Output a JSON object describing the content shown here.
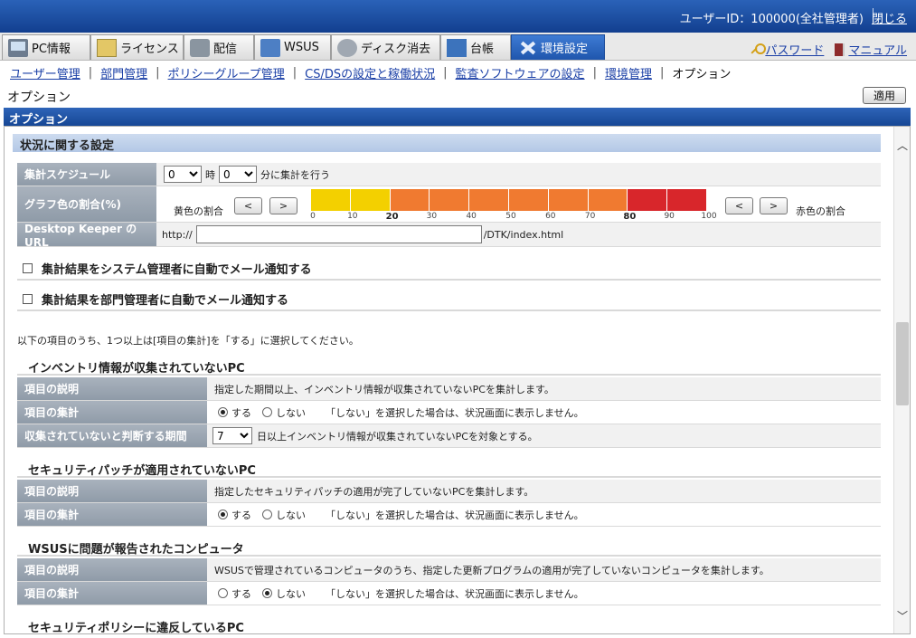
{
  "header": {
    "user_label": "ユーザーID：100000(全社管理者)",
    "close": "閉じる"
  },
  "tabs": [
    {
      "label": "PC情報",
      "icon": "pc-icon"
    },
    {
      "label": "ライセンス",
      "icon": "license-icon"
    },
    {
      "label": "配信",
      "icon": "distribution-icon"
    },
    {
      "label": "WSUS",
      "icon": "wsus-icon"
    },
    {
      "label": "ディスク消去",
      "icon": "disk-erase-icon"
    },
    {
      "label": "台帳",
      "icon": "ledger-icon"
    },
    {
      "label": "環境設定",
      "icon": "tools-icon"
    }
  ],
  "toplinks": {
    "password": "パスワード",
    "manual": "マニュアル"
  },
  "submenu": [
    "ユーザー管理",
    "部門管理",
    "ポリシーグループ管理",
    "CS/DSの設定と稼働状況",
    "監査ソフトウェアの設定",
    "環境管理",
    "オプション"
  ],
  "page": {
    "title": "オプション",
    "apply": "適用",
    "panel_title": "オプション"
  },
  "status_settings": {
    "heading": "状況に関する設定",
    "schedule": {
      "label": "集計スケジュール",
      "hour": "0",
      "hour_unit": "時",
      "minute": "0",
      "suffix": "分に集計を行う"
    },
    "graph": {
      "label": "グラフ色の割合(%)",
      "yellow_label": "黄色の割合",
      "red_label": "赤色の割合",
      "prev": "<",
      "next": ">",
      "ticks": [
        "0",
        "10",
        "20",
        "30",
        "40",
        "50",
        "60",
        "70",
        "80",
        "90",
        "100"
      ],
      "yellow_pct": 20,
      "red_pct": 80,
      "colors": {
        "yellow": "#f3d000",
        "orange": "#f07a30",
        "red": "#d8262b"
      }
    },
    "url": {
      "label": "Desktop Keeper のURL",
      "prefix": "http://",
      "value": "",
      "suffix": "/DTK/index.html"
    }
  },
  "checks": [
    {
      "label": "集計結果をシステム管理者に自動でメール通知する",
      "checked": false
    },
    {
      "label": "集計結果を部門管理者に自動でメール通知する",
      "checked": false
    }
  ],
  "note": "以下の項目のうち、1つ以上は[項目の集計]を「する」に選択してください。",
  "items": [
    {
      "heading": "インベントリ情報が収集されていないPC",
      "desc_label": "項目の説明",
      "desc": "指定した期間以上、インベントリ情報が収集されていないPCを集計します。",
      "count_label": "項目の集計",
      "yes": "する",
      "no": "しない",
      "selected": "yes",
      "hint": "「しない」を選択した場合は、状況画面に表示しません。",
      "period_label": "収集されていないと判断する期間",
      "period": "7",
      "period_suffix": "日以上インベントリ情報が収集されていないPCを対象とする。"
    },
    {
      "heading": "セキュリティパッチが適用されていないPC",
      "desc_label": "項目の説明",
      "desc": "指定したセキュリティパッチの適用が完了していないPCを集計します。",
      "count_label": "項目の集計",
      "yes": "する",
      "no": "しない",
      "selected": "yes",
      "hint": "「しない」を選択した場合は、状況画面に表示しません。"
    },
    {
      "heading": "WSUSに問題が報告されたコンピュータ",
      "desc_label": "項目の説明",
      "desc": "WSUSで管理されているコンピュータのうち、指定した更新プログラムの適用が完了していないコンピュータを集計します。",
      "count_label": "項目の集計",
      "yes": "する",
      "no": "しない",
      "selected": "no",
      "hint": "「しない」を選択した場合は、状況画面に表示しません。"
    },
    {
      "heading": "セキュリティポリシーに違反しているPC"
    }
  ]
}
